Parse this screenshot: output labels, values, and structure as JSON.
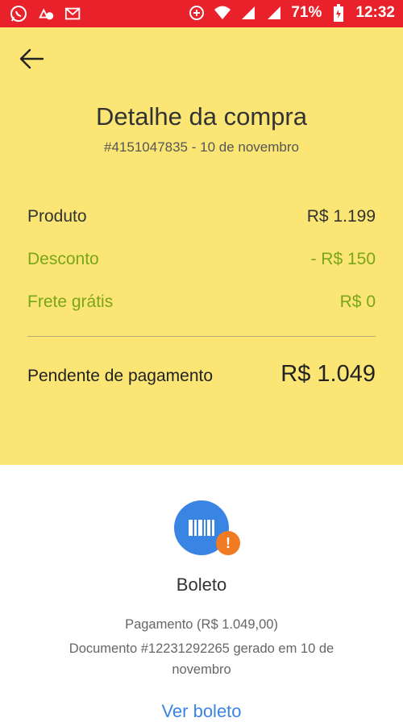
{
  "status_bar": {
    "icons_left": [
      "whatsapp-icon",
      "recycle-alert-icon",
      "mail-alert-icon"
    ],
    "battery": "71%",
    "time": "12:32"
  },
  "header": {
    "title": "Detalhe da compra",
    "subtitle": "#4151047835 - 10 de novembro"
  },
  "summary": {
    "rows": [
      {
        "label": "Produto",
        "value": "R$ 1.199"
      },
      {
        "label": "Desconto",
        "value": "- R$ 150"
      },
      {
        "label": "Frete grátis",
        "value": "R$ 0"
      }
    ],
    "total_label": "Pendente de pagamento",
    "total_value": "R$ 1.049"
  },
  "payment": {
    "method": "Boleto",
    "amount_text": "Pagamento (R$ 1.049,00)",
    "document_text": "Documento #12231292265 gerado em 10 de novembro",
    "link_label": "Ver boleto"
  },
  "colors": {
    "status_bar": "#e8212a",
    "yellow_bg": "#fbe675",
    "discount_green": "#7aa51a",
    "accent_blue": "#3a84e3",
    "alert_orange": "#f07b22"
  }
}
